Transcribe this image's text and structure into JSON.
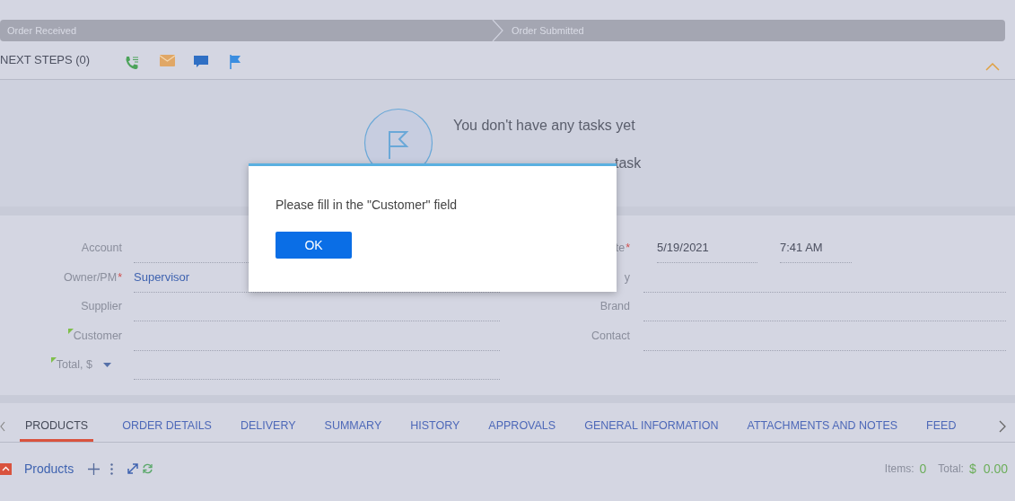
{
  "stages": [
    {
      "label": "Order Received"
    },
    {
      "label": "Order Submitted"
    }
  ],
  "next_steps": {
    "title": "NEXT STEPS (0)",
    "empty_title": "You don't have any tasks yet",
    "empty_hint": "task"
  },
  "form_left": [
    {
      "label": "Account",
      "highlighted": false,
      "dropdown": false
    },
    {
      "label": "Owner/PM",
      "required_mark": "*",
      "highlighted": false,
      "dropdown": false,
      "value": "Supervisor"
    },
    {
      "label": "Supplier",
      "highlighted": false,
      "dropdown": false
    },
    {
      "label": "Customer",
      "highlighted": true,
      "dropdown": false
    },
    {
      "label": "Total, $",
      "highlighted": true,
      "dropdown": true
    }
  ],
  "form_right": [
    {
      "label": "te",
      "required_mark": "*",
      "values": [
        "5/19/2021",
        "7:41 AM"
      ]
    },
    {
      "label": "y"
    },
    {
      "label": "Brand"
    },
    {
      "label": "Contact"
    }
  ],
  "tabs": [
    {
      "label": "PRODUCTS",
      "selected": true
    },
    {
      "label": "ORDER DETAILS",
      "selected": false
    },
    {
      "label": "DELIVERY",
      "selected": false
    },
    {
      "label": "SUMMARY",
      "selected": false
    },
    {
      "label": "HISTORY",
      "selected": false
    },
    {
      "label": "APPROVALS",
      "selected": false
    },
    {
      "label": "GENERAL INFORMATION",
      "selected": false
    },
    {
      "label": "ATTACHMENTS AND NOTES",
      "selected": false
    },
    {
      "label": "FEED",
      "selected": false
    }
  ],
  "products": {
    "title": "Products",
    "items_label": "Items:",
    "items_value": "0",
    "total_label": "Total:",
    "total_currency": "$",
    "total_value": "0.00"
  },
  "dialog": {
    "message": "Please fill in the \"Customer\" field",
    "button": "OK"
  }
}
